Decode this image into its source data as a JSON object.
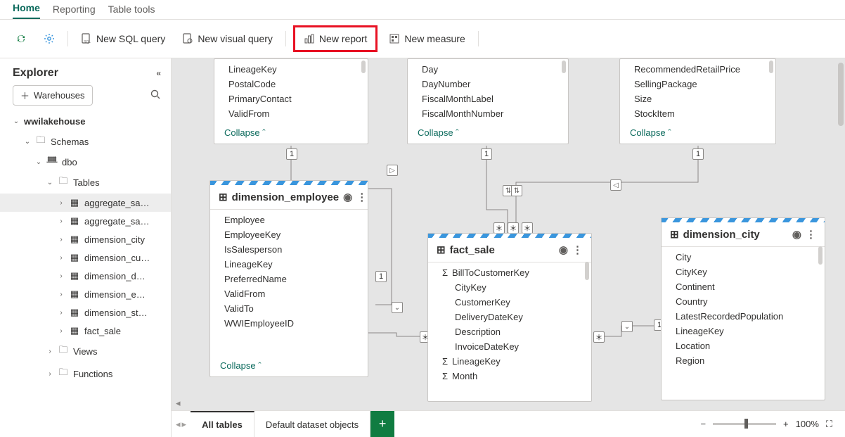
{
  "tabs": {
    "home": "Home",
    "reporting": "Reporting",
    "tools": "Table tools"
  },
  "toolbar": {
    "sql": "New SQL query",
    "visual": "New visual query",
    "report": "New report",
    "measure": "New measure"
  },
  "explorer": {
    "title": "Explorer",
    "wh_btn": "Warehouses",
    "db": "wwilakehouse",
    "schemas": "Schemas",
    "dbo": "dbo",
    "tables": "Tables",
    "items": [
      "aggregate_sa…",
      "aggregate_sa…",
      "dimension_city",
      "dimension_cu…",
      "dimension_d…",
      "dimension_e…",
      "dimension_st…",
      "fact_sale"
    ],
    "views": "Views",
    "functions": "Functions"
  },
  "cards": {
    "collapse": "Collapse",
    "c1_cols": [
      "LineageKey",
      "PostalCode",
      "PrimaryContact",
      "ValidFrom"
    ],
    "c2_cols": [
      "Day",
      "DayNumber",
      "FiscalMonthLabel",
      "FiscalMonthNumber"
    ],
    "c3_cols": [
      "RecommendedRetailPrice",
      "SellingPackage",
      "Size",
      "StockItem"
    ],
    "emp": {
      "title": "dimension_employee",
      "cols": [
        "Employee",
        "EmployeeKey",
        "IsSalesperson",
        "LineageKey",
        "PreferredName",
        "ValidFrom",
        "ValidTo",
        "WWIEmployeeID"
      ]
    },
    "fact": {
      "title": "fact_sale",
      "cols": [
        "BillToCustomerKey",
        "CityKey",
        "CustomerKey",
        "DeliveryDateKey",
        "Description",
        "InvoiceDateKey",
        "LineageKey",
        "Month"
      ],
      "sigma": [
        true,
        false,
        false,
        false,
        false,
        false,
        true,
        true
      ]
    },
    "city": {
      "title": "dimension_city",
      "cols": [
        "City",
        "CityKey",
        "Continent",
        "Country",
        "LatestRecordedPopulation",
        "LineageKey",
        "Location",
        "Region"
      ]
    }
  },
  "bottom": {
    "all": "All tables",
    "default": "Default dataset objects",
    "zoom": "100%"
  }
}
